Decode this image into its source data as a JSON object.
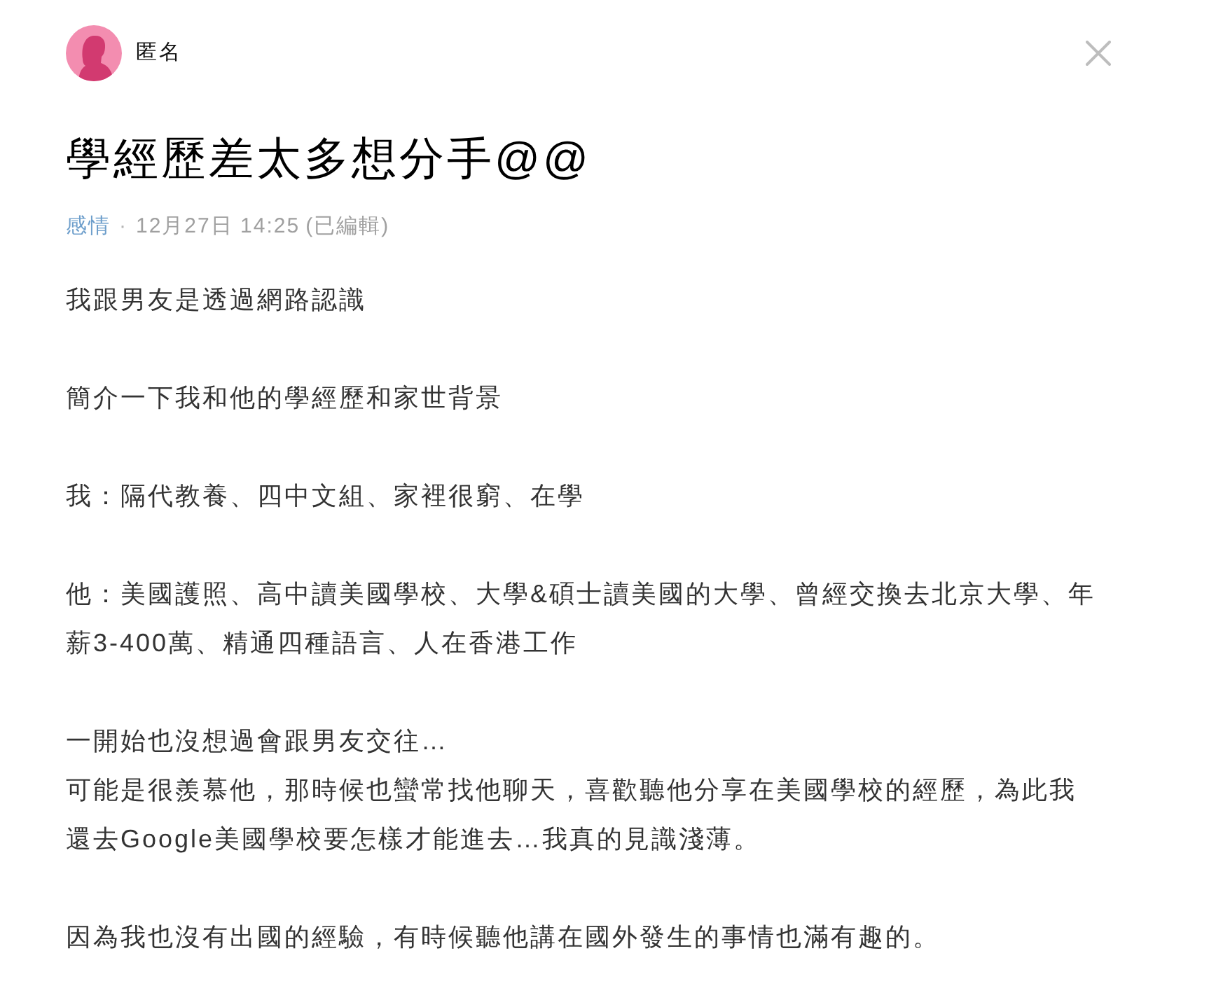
{
  "author": {
    "name": "匿名"
  },
  "title": "學經歷差太多想分手@@",
  "meta": {
    "category": "感情",
    "separator": "·",
    "time": "12月27日 14:25",
    "edited": "(已編輯)"
  },
  "body": [
    {
      "lines": [
        "我跟男友是透過網路認識"
      ]
    },
    {
      "lines": [
        "簡介一下我和他的學經歷和家世背景"
      ]
    },
    {
      "lines": [
        "我：隔代教養、四中文組、家裡很窮、在學"
      ]
    },
    {
      "lines": [
        "他：美國護照、高中讀美國學校、大學&碩士讀美國的大學、曾經交換去北京大學、年薪3-400萬、精通四種語言、人在香港工作"
      ]
    },
    {
      "lines": [
        "一開始也沒想過會跟男友交往…",
        "可能是很羨慕他，那時候也蠻常找他聊天，喜歡聽他分享在美國學校的經歷，為此我還去Google美國學校要怎樣才能進去…我真的見識淺薄。"
      ]
    },
    {
      "lines": [
        "因為我也沒有出國的經驗，有時候聽他講在國外發生的事情也滿有趣的。"
      ]
    }
  ]
}
